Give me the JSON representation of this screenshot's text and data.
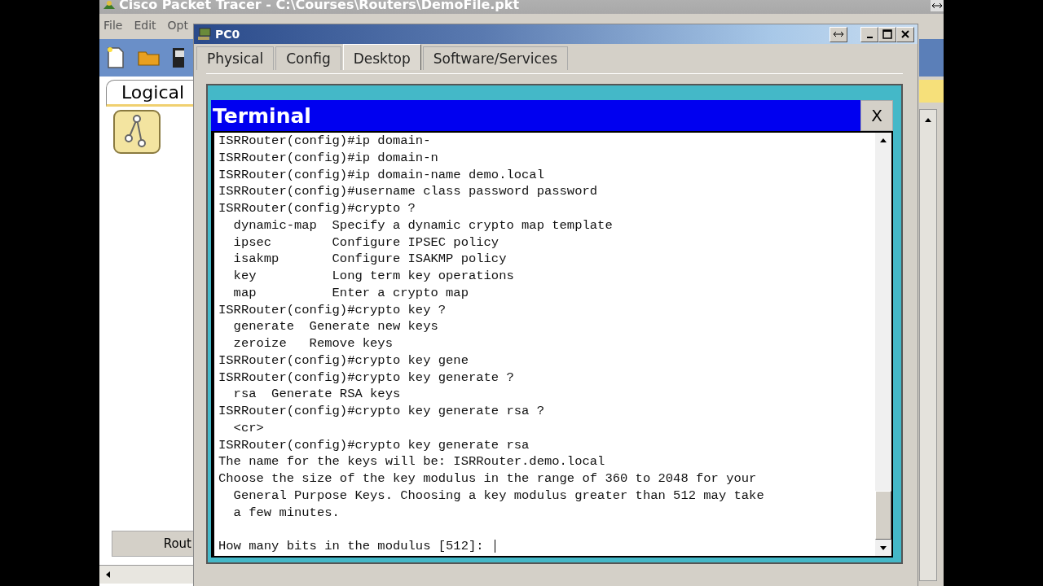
{
  "app": {
    "title": "Cisco Packet Tracer - C:\\Courses\\Routers\\DemoFile.pkt",
    "menu": [
      "File",
      "Edit",
      "Opt"
    ],
    "workspace_tab": "Logical",
    "device_button": "Rout"
  },
  "window": {
    "title": "PC0",
    "tabs": [
      {
        "label": "Physical",
        "selected": false
      },
      {
        "label": "Config",
        "selected": false
      },
      {
        "label": "Desktop",
        "selected": true
      },
      {
        "label": "Software/Services",
        "selected": false
      }
    ]
  },
  "terminal": {
    "title": "Terminal",
    "close": "X",
    "lines": [
      "ISRRouter(config)#ip domain-",
      "ISRRouter(config)#ip domain-n",
      "ISRRouter(config)#ip domain-name demo.local",
      "ISRRouter(config)#username class password password",
      "ISRRouter(config)#crypto ?",
      "  dynamic-map  Specify a dynamic crypto map template",
      "  ipsec        Configure IPSEC policy",
      "  isakmp       Configure ISAKMP policy",
      "  key          Long term key operations",
      "  map          Enter a crypto map",
      "ISRRouter(config)#crypto key ?",
      "  generate  Generate new keys",
      "  zeroize   Remove keys",
      "ISRRouter(config)#crypto key gene",
      "ISRRouter(config)#crypto key generate ?",
      "  rsa  Generate RSA keys",
      "ISRRouter(config)#crypto key generate rsa ?",
      "  <cr>",
      "ISRRouter(config)#crypto key generate rsa",
      "The name for the keys will be: ISRRouter.demo.local",
      "Choose the size of the key modulus in the range of 360 to 2048 for your",
      "  General Purpose Keys. Choosing a key modulus greater than 512 may take",
      "  a few minutes."
    ],
    "prompt": "How many bits in the modulus [512]: "
  }
}
